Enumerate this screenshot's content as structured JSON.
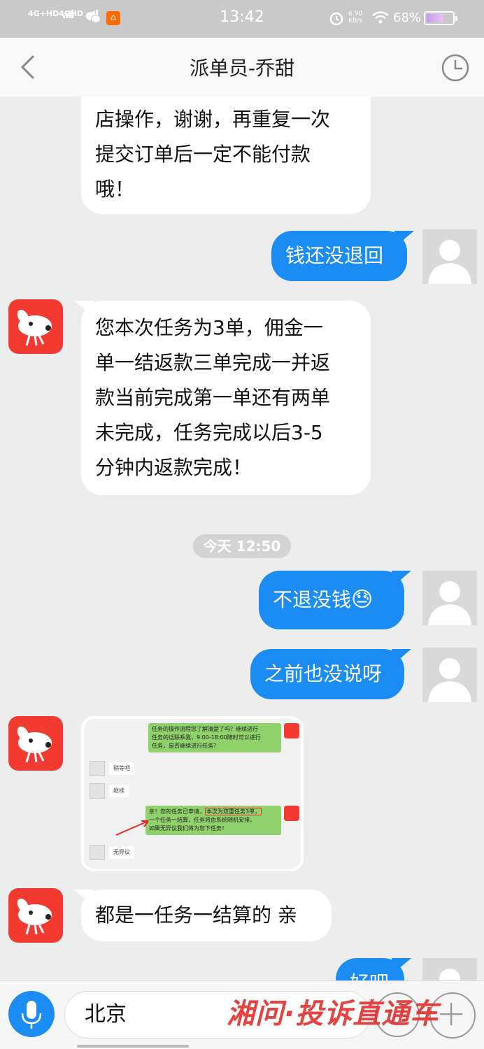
{
  "status_bar": {
    "signal1": "4G+HD",
    "signal2": "4GHD",
    "time": "13:42",
    "net_speed_value": "6.90",
    "net_speed_unit": "KB/s",
    "battery_percent": "68%",
    "battery_level": 0.68,
    "icons": [
      "wechat-icon",
      "app-notification-icon",
      "alarm-icon",
      "wifi-icon",
      "battery-icon"
    ]
  },
  "header": {
    "title": "派单员-乔甜",
    "back_icon": "chevron-left-icon",
    "history_icon": "clock-icon"
  },
  "messages": [
    {
      "side": "in",
      "lines": [
        "店操作，谢谢，再重复一次",
        "提交订单后一定不能付款",
        "哦！"
      ]
    },
    {
      "side": "out",
      "text": "钱还没退回"
    },
    {
      "side": "in",
      "lines": [
        "您本次任务为3单，佣金一",
        "单一结返款三单完成一并返",
        "款当前完成第一单还有两单",
        "未完成，任务完成以后3-5",
        "分钟内返款完成！"
      ]
    },
    {
      "side": "timestamp",
      "text": "今天 12:50"
    },
    {
      "side": "out",
      "text": "不退没钱",
      "emoji": "😓"
    },
    {
      "side": "out",
      "text": "之前也没说呀"
    },
    {
      "side": "in",
      "type": "image"
    },
    {
      "side": "in",
      "text": "都是一任务一结算的 亲"
    },
    {
      "side": "out",
      "text": "好吧"
    }
  ],
  "image_message": {
    "bubble1": [
      "任务的操作流程您了解清楚了吗？继续进行",
      "任务的话联系我，9.00-18:00随时可以进行",
      "任务，是否继续进行任务？"
    ],
    "reply1": "稍等吧",
    "reply2": "继续",
    "bubble2_prefix": "亲！您的任务已申请，",
    "bubble2_highlight": "本次为双重任务3单，",
    "bubble2_rest": [
      "一个任务一结算，任务将由系统随机安排，",
      "如果无异议我们将为您下任务！"
    ],
    "reply3": "无异议"
  },
  "input_bar": {
    "value": "北京",
    "watermark": "湘问·投诉直通车",
    "mic_icon": "microphone-icon",
    "emoji_icon": "smiley-icon",
    "plus_icon": "plus-icon"
  },
  "colors": {
    "outgoing_bubble": "#1b8cf3",
    "incoming_bubble": "#ffffff",
    "jd_avatar": "#f23a30",
    "background": "#ededed"
  }
}
